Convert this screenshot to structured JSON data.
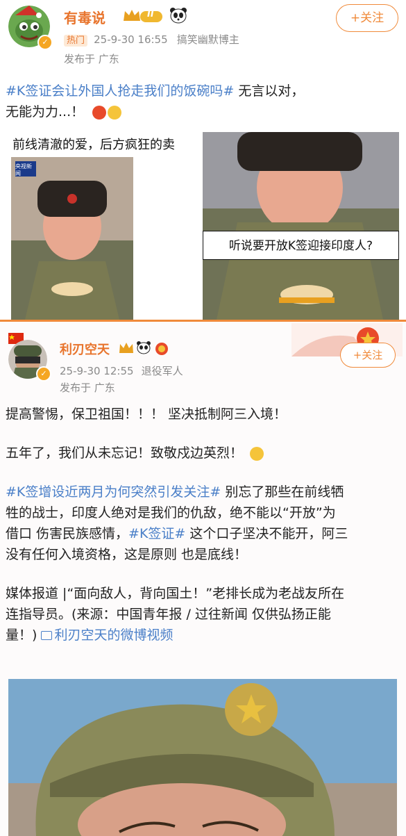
{
  "post1": {
    "username": "有毒说",
    "level_badge": "II",
    "hot_label": "热门",
    "timestamp": "25-9-30 16:55",
    "user_tag": "搞笑幽默博主",
    "location": "发布于 广东",
    "follow_label": "+关注",
    "hashtag": "#K签证会让外国人抢走我们的饭碗吗#",
    "text_after": " 无言以对，",
    "text_line2": "无能为力...！",
    "image_top_text": "前线清澈的爱，后方疯狂的卖",
    "image_caption": "听说要开放K签迎接印度人?",
    "image_logo": "央视新闻"
  },
  "post2": {
    "username": "利刃空天",
    "timestamp": "25-9-30 12:55",
    "user_tag": "退役军人",
    "location": "发布于 广东",
    "follow_label": "+关注",
    "para1": "提高警惕，保卫祖国！！！ 坚决抵制阿三入境！",
    "para2": "五年了，我们从未忘记！致敬戍边英烈！",
    "para3_tag1": "#K签增设近两月为何突然引发关注#",
    "para3_a": " 别忘了那些在前线牺",
    "para3_b": "牲的战士，印度人绝对是我们的仇敌，绝不能以“开放”为",
    "para3_c": "借口 伤害民族感情，",
    "para3_tag2": "#K签证#",
    "para3_d": " 这个口子坚决不能开，阿三",
    "para3_e": "没有任何入境资格，这是原则 也是底线！",
    "para4_a": "媒体报道 |“面向敌人，背向国土！”老排长成为老战友所在",
    "para4_b": "连指导员。(来源：中国青年报 / 过往新闻 仅供弘扬正能",
    "para4_c": "量！)",
    "video_link": "利刃空天的微博视频"
  },
  "colors": {
    "accent": "#f08a3a",
    "link": "#4a7fc8"
  }
}
